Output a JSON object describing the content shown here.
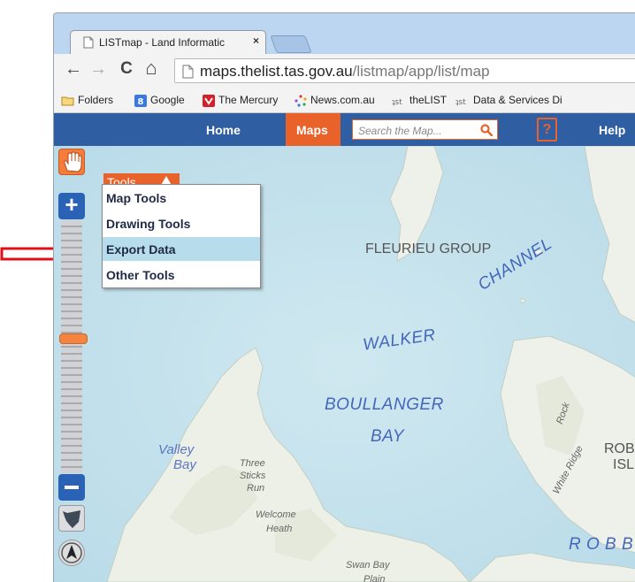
{
  "browser": {
    "tab_title": "LISTmap - Land Informatic",
    "close_glyph": "×",
    "url_host": "maps.thelist.tas.gov.au",
    "url_path": "/listmap/app/list/map",
    "back_glyph": "←",
    "forward_glyph": "→",
    "reload_glyph": "C",
    "home_glyph": "⌂"
  },
  "bookmarks": [
    {
      "label": "Folders",
      "icon": "folder-icon"
    },
    {
      "label": "Google",
      "icon": "google-icon"
    },
    {
      "label": "The Mercury",
      "icon": "mercury-icon"
    },
    {
      "label": "News.com.au",
      "icon": "news-icon"
    },
    {
      "label": "theLIST",
      "icon": "thelist-icon"
    },
    {
      "label": "Data & Services Di",
      "icon": "thelist-icon"
    }
  ],
  "site_nav": {
    "home": "Home",
    "maps": "Maps",
    "search_placeholder": "Search the Map...",
    "help_icon_glyph": "?",
    "help": "Help"
  },
  "tools": {
    "header": "Tools",
    "items": [
      "Map Tools",
      "Drawing Tools",
      "Export Data",
      "Other Tools"
    ],
    "highlighted": "Export Data"
  },
  "zoom": {
    "in_glyph": "+",
    "level_fraction": 0.44
  },
  "map_labels": {
    "fleurieu": "FLEURIEU GROUP",
    "channel": "CHANNEL",
    "walker": "WALKER",
    "boullanger": "BOULLANGER",
    "bay": "BAY",
    "valley": "Valley",
    "valley_bay": "Bay",
    "three": "Three",
    "sticks": "Sticks",
    "run": "Run",
    "welcome": "Welcome",
    "heath": "Heath",
    "swan_bay": "Swan  Bay",
    "plain": "Plain",
    "rock": "Rock",
    "white_ridge": "White  Ridge",
    "rob": "ROB",
    "isl": "ISL",
    "robb": "R O B B"
  },
  "colors": {
    "nav_blue": "#2f5ea3",
    "accent_orange": "#e8622a",
    "water": "#c6e2ee",
    "land": "#eef1ea",
    "annotation_red": "#e0101a",
    "menu_highlight": "#b7dcec"
  }
}
